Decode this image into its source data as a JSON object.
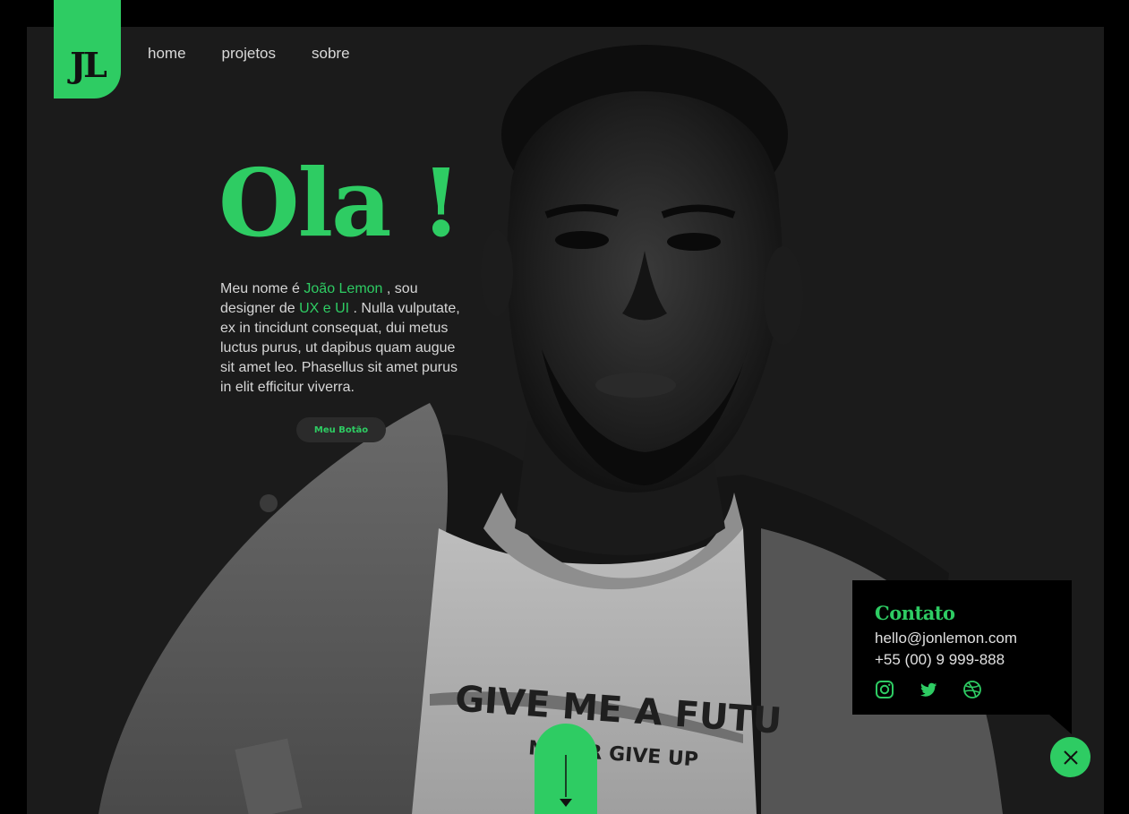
{
  "brand": {
    "logo_text": "JL"
  },
  "nav": {
    "items": [
      "home",
      "projetos",
      "sobre"
    ]
  },
  "hero": {
    "title": "Ola !",
    "intro_prefix": "Meu nome é ",
    "intro_name": "João Lemon",
    "intro_mid": " , sou designer de ",
    "intro_role": "UX e UI",
    "intro_suffix": " . Nulla vulputate, ex in tincidunt consequat, dui metus luctus purus, ut dapibus quam augue sit amet leo. Phasellus sit amet purus in elit efficitur viverra.",
    "button_label": "Meu Botão",
    "shirt_text_1": "GIVE ME A FUTU",
    "shirt_text_2": "NEVER GIVE UP"
  },
  "contact": {
    "title": "Contato",
    "email": "hello@jonlemon.com",
    "phone": "+55 (00) 9 999-888",
    "socials": [
      "instagram-icon",
      "twitter-icon",
      "dribbble-icon"
    ]
  },
  "colors": {
    "accent": "#2ecc63",
    "background": "#000000",
    "panel": "#1b1b1b",
    "text": "#d6d6d6"
  }
}
